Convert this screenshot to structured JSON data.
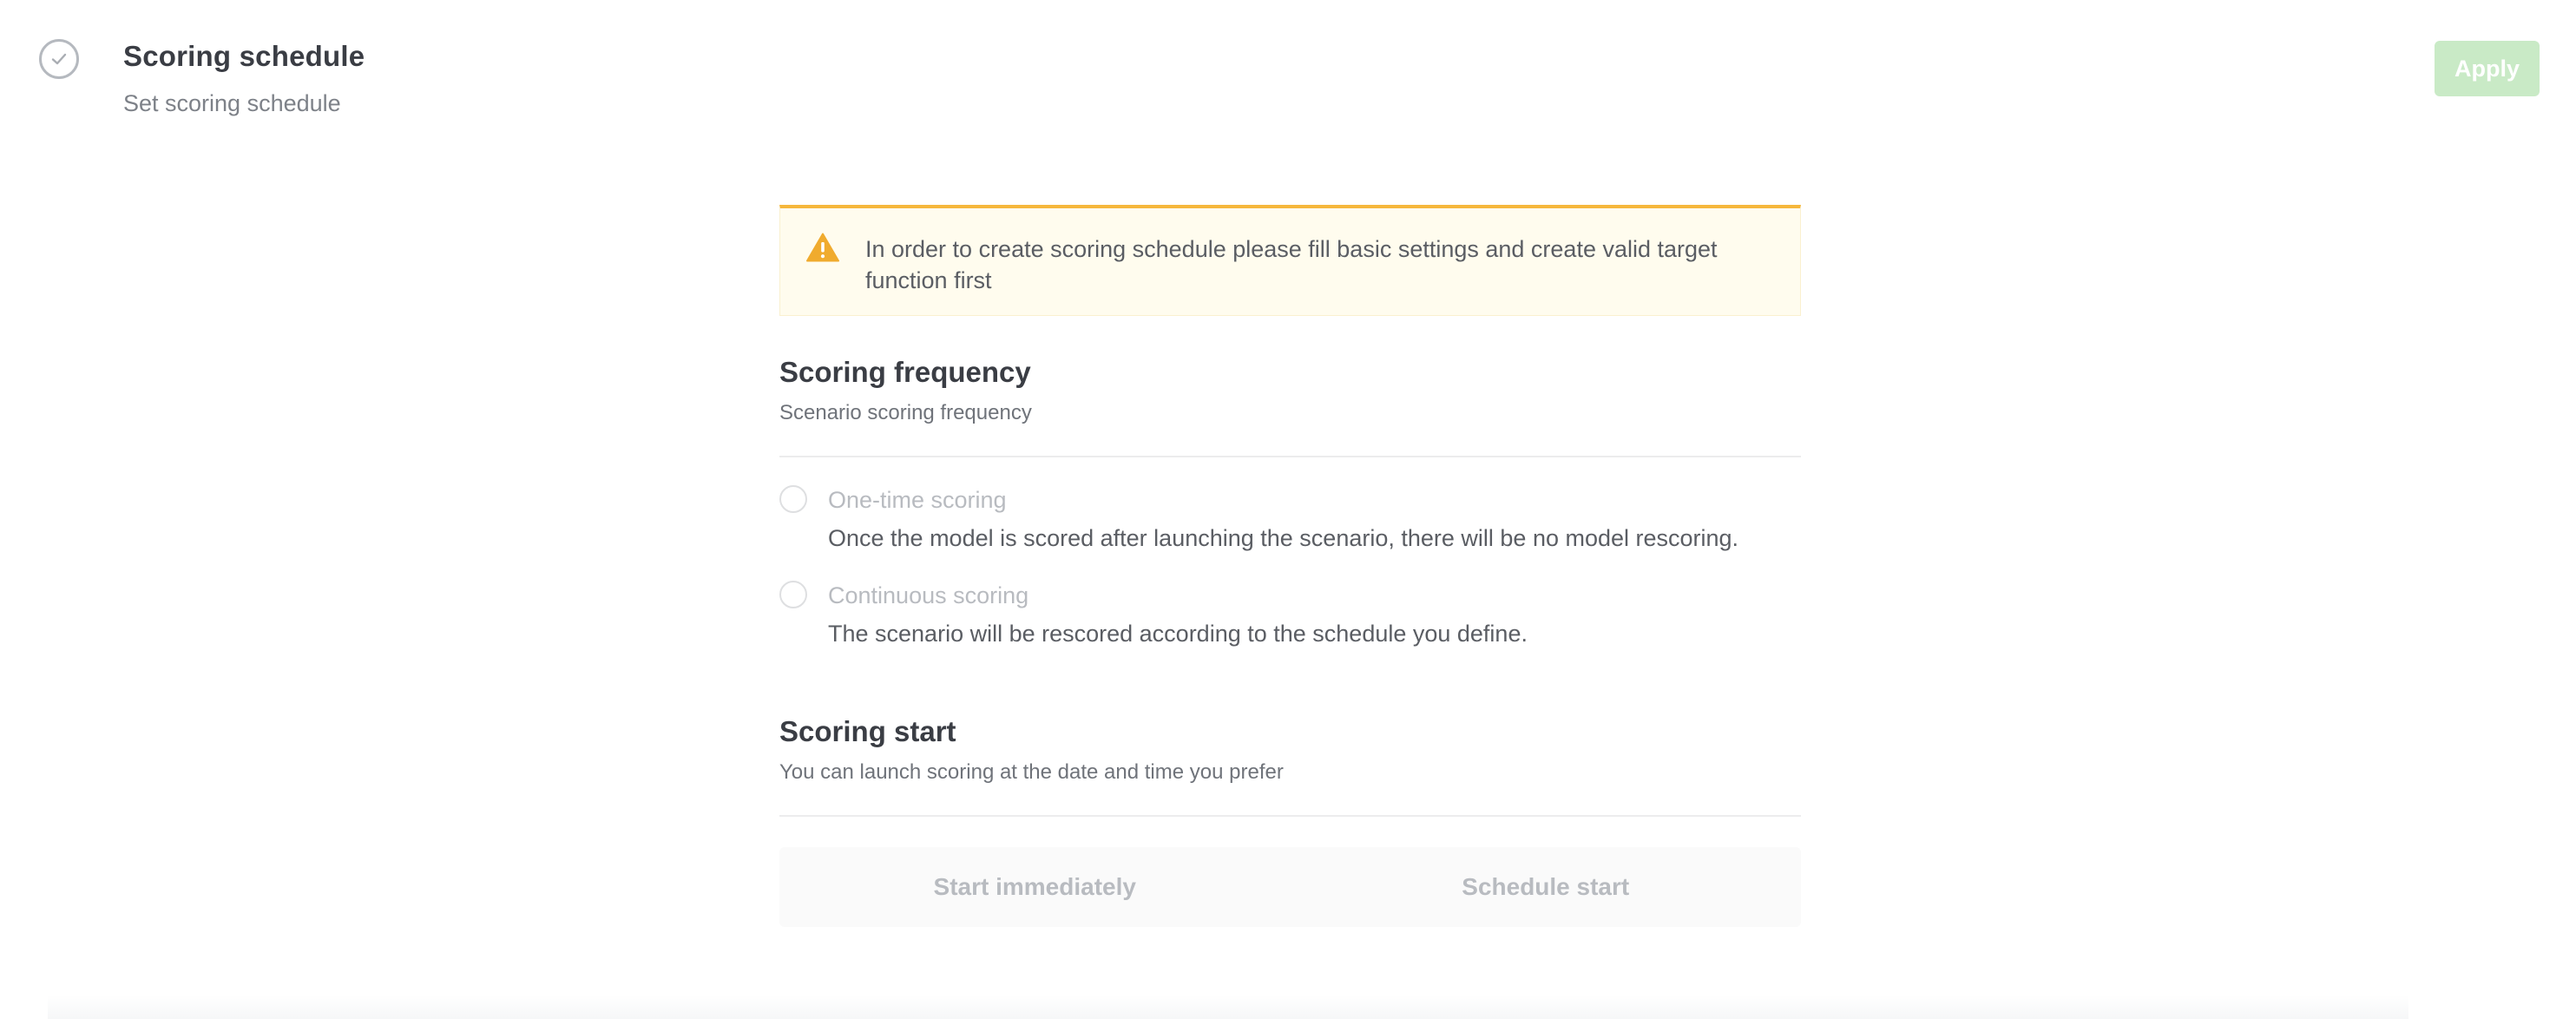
{
  "header": {
    "title": "Scoring schedule",
    "subtitle": "Set scoring schedule",
    "apply_label": "Apply",
    "apply_color": "#c9eac6",
    "status_icon": "check-circle-icon"
  },
  "alert": {
    "icon": "warning-icon",
    "accent_color": "#f6b73c",
    "text": "In order to create scoring schedule please fill basic settings and create valid target function first"
  },
  "frequency": {
    "title": "Scoring frequency",
    "subtitle": "Scenario scoring frequency",
    "options": [
      {
        "label": "One-time scoring",
        "description": "Once the model is scored after launching the scenario, there will be no model rescoring.",
        "selected": false
      },
      {
        "label": "Continuous scoring",
        "description": "The scenario will be rescored according to the schedule you define.",
        "selected": false
      }
    ]
  },
  "start": {
    "title": "Scoring start",
    "subtitle": "You can launch scoring at the date and time you prefer",
    "buttons": [
      "Start immediately",
      "Schedule start"
    ]
  }
}
